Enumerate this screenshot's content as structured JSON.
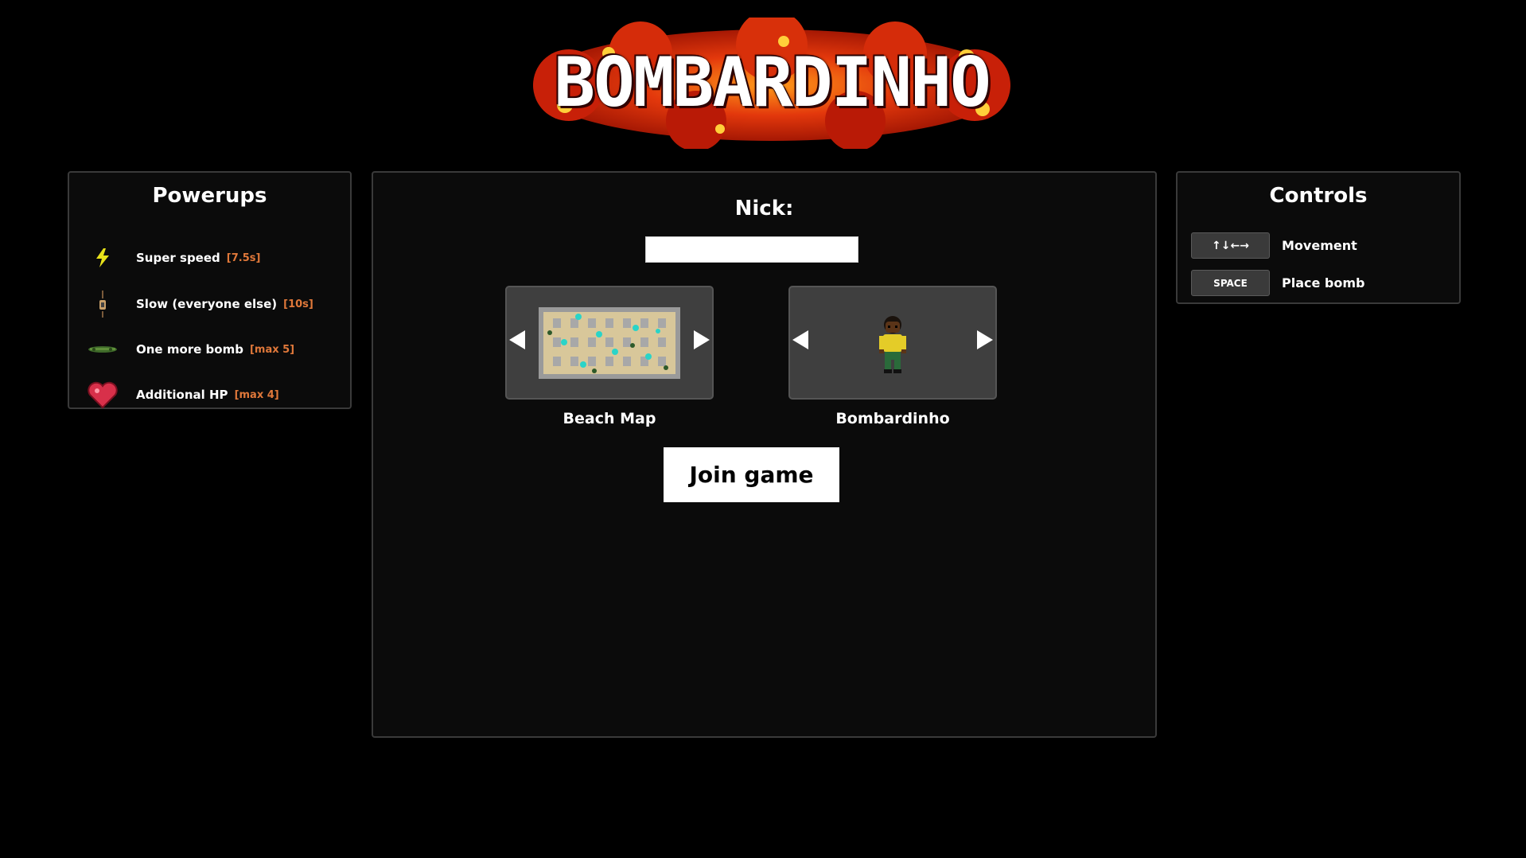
{
  "header": {
    "title": "BOMBARDINHO"
  },
  "powerups": {
    "title": "Powerups",
    "items": [
      {
        "icon": "lightning-icon",
        "label": "Super speed",
        "note": "[7.5s]"
      },
      {
        "icon": "hourglass-icon",
        "label": "Slow (everyone else)",
        "note": "[10s]"
      },
      {
        "icon": "bomb-plus-icon",
        "label": "One more bomb",
        "note": "[max 5]"
      },
      {
        "icon": "heart-icon",
        "label": "Additional HP",
        "note": "[max 4]"
      }
    ]
  },
  "lobby": {
    "nick_label": "Nick:",
    "nick_value": "",
    "map_name": "Beach Map",
    "character_name": "Bombardinho",
    "join_label": "Join game"
  },
  "controls": {
    "title": "Controls",
    "items": [
      {
        "key": "↑↓←→",
        "label": "Movement"
      },
      {
        "key": "SPACE",
        "label": "Place bomb"
      }
    ]
  },
  "colors": {
    "background": "#000000",
    "panel": "#0b0b0b",
    "note": "#e0783a",
    "fire": "#d32a0a"
  }
}
